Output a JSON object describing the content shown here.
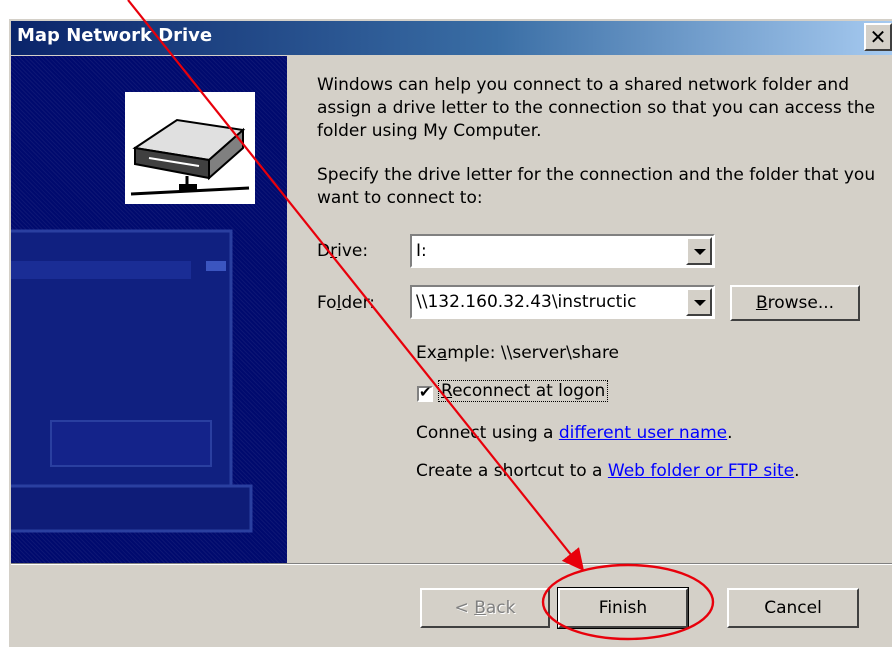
{
  "window": {
    "title": "Map Network Drive",
    "close_label": "✕"
  },
  "intro": "Windows can help you connect to a shared network folder and assign a drive letter to the connection so that you can access the folder using My Computer.",
  "instruction": "Specify the drive letter for the connection and the folder that you want to connect to:",
  "drive": {
    "label_pre": "D",
    "label_accel": "r",
    "label_post": "ive:",
    "value": "I:"
  },
  "folder": {
    "label_pre": "Fo",
    "label_accel": "l",
    "label_post": "der:",
    "value": "\\\\132.160.32.43\\instructic"
  },
  "browse": {
    "accel": "B",
    "rest": "rowse..."
  },
  "example": {
    "pre": "Ex",
    "accel": "a",
    "post": "mple: \\\\server\\share"
  },
  "reconnect": {
    "checked": true,
    "accel": "R",
    "rest": "econnect at logon"
  },
  "connect_line": {
    "pre": "Connect using a ",
    "link": "different user name",
    "post": "."
  },
  "shortcut_line": {
    "pre": "Create a shortcut to a ",
    "link": "Web folder or FTP site",
    "post": "."
  },
  "buttons": {
    "back_pre": "< ",
    "back_accel": "B",
    "back_rest": "ack",
    "finish": "Finish",
    "cancel": "Cancel"
  },
  "colors": {
    "annotation": "#e8000b",
    "title_start": "#0a246a",
    "title_end": "#a6caf0",
    "art_background": "#000a6e",
    "dialog_face": "#d4d0c8",
    "link": "#0000ff"
  },
  "icons": [
    "network-drive-icon",
    "close-icon",
    "dropdown-arrow-icon",
    "checkmark-icon",
    "annotation-arrow-icon",
    "annotation-circle-icon"
  ]
}
